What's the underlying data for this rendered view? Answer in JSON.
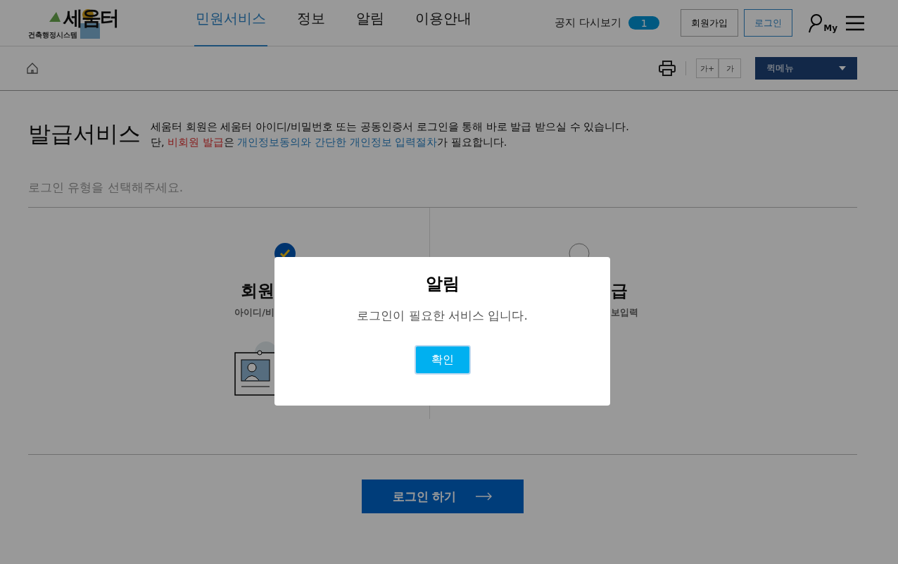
{
  "header": {
    "logo": {
      "name": "세움터",
      "subtitle": "건축행정시스템"
    },
    "nav": [
      {
        "label": "민원서비스",
        "selected": true
      },
      {
        "label": "정보",
        "selected": false
      },
      {
        "label": "알림",
        "selected": false
      },
      {
        "label": "이용안내",
        "selected": false
      }
    ],
    "notice": {
      "label": "공지 다시보기",
      "count": "1"
    },
    "buttons": [
      {
        "label": "회원가입",
        "kind": "plain"
      },
      {
        "label": "로그인",
        "kind": "primary"
      }
    ],
    "my_label": "My"
  },
  "toolbar": {
    "font_buttons": [
      "가+",
      "가"
    ],
    "quick_menu": "퀵메뉴"
  },
  "page": {
    "title": "발급서비스",
    "description": [
      [
        {
          "text": "세움터 회원은 세움터 아이디/비밀번호 또는 공동인증서 로그인을 통해 바로 발급 받으실 수 있습니다.",
          "kind": "plain"
        }
      ],
      [
        {
          "text": "단, ",
          "kind": "plain"
        },
        {
          "text": "비회원 발급",
          "kind": "alert"
        },
        {
          "text": "은 ",
          "kind": "plain"
        },
        {
          "text": "개인정보동의와 간단한 개인정보 입력절차",
          "kind": "info"
        },
        {
          "text": "가 필요합니다.",
          "kind": "plain"
        }
      ]
    ],
    "prompt": "로그인 유형을 선택해주세요.",
    "cards": [
      {
        "title": "회원",
        "subtitle": "아이디/비",
        "selected": true
      },
      {
        "title": "급",
        "subtitle": "보입력",
        "selected": false
      }
    ],
    "submit": "로그인 하기"
  },
  "dialog": {
    "title": "알림",
    "message": "로그인이 필요한 서비스 입니다.",
    "button": "확인"
  }
}
